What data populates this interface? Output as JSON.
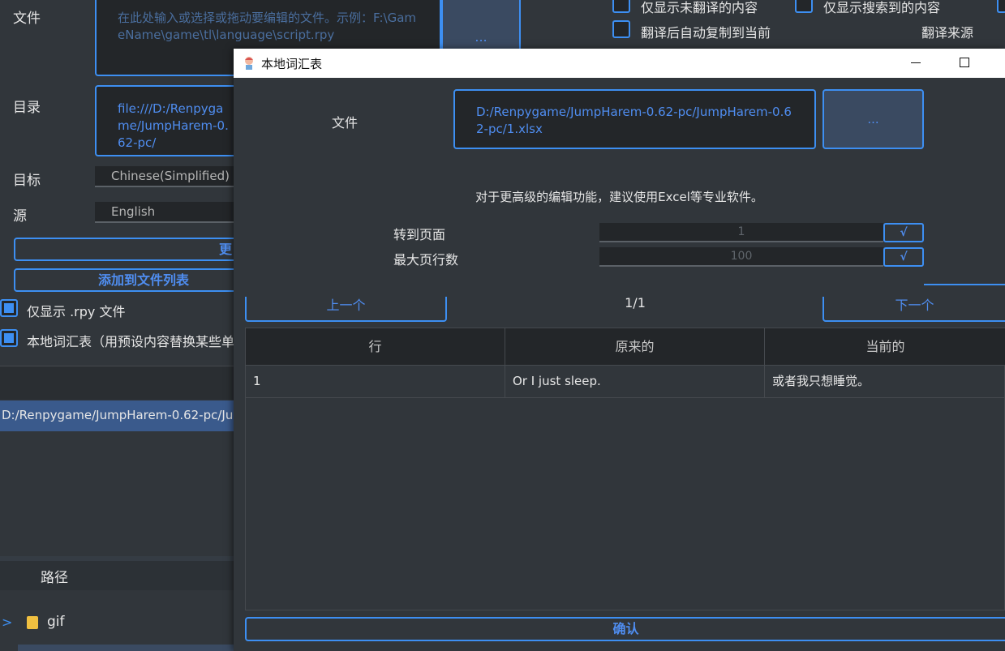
{
  "main": {
    "file_label": "文件",
    "file_placeholder": "在此处输入或选择或拖动要编辑的文件。示例：F:\\GameName\\game\\tl\\language\\script.rpy",
    "file_browse": "...",
    "dir_label": "目录",
    "dir_value": "file:///D:/Renpygame/JumpHarem-0.62-pc/",
    "target_label": "目标",
    "target_value": "Chinese(Simplified)",
    "source_label": "源",
    "source_value": "English",
    "button_update_partial": "更",
    "button_add_to_list": "添加到文件列表",
    "checkbox_rpy_only": "仅显示 .rpy 文件",
    "checkbox_local_glossary": "本地词汇表（用预设内容替换某些单",
    "checkbox_untranslated": "仅显示未翻译的内容",
    "checkbox_searched": "仅显示搜索到的内容",
    "checkbox_autocopy": "翻译后自动复制到当前",
    "translate_source_label": "翻译来源",
    "selected_path": "D:/Renpygame/JumpHarem-0.62-pc/Ju",
    "tree_header": "路径",
    "tree_item": "gif"
  },
  "dialog": {
    "title": "本地词汇表",
    "file_label": "文件",
    "file_value": "D:/Renpygame/JumpHarem-0.62-pc/JumpHarem-0.62-pc/1.xlsx",
    "browse_label": "...",
    "hint": "对于更高级的编辑功能，建议使用Excel等专业软件。",
    "goto_page_label": "转到页面",
    "goto_page_value": "1",
    "max_rows_label": "最大页行数",
    "max_rows_value": "100",
    "ok_mark": "√",
    "prev_label": "上一个",
    "next_label": "下一个",
    "page_indicator": "1/1",
    "columns": [
      "行",
      "原来的",
      "当前的"
    ],
    "rows": [
      {
        "row": "1",
        "original": "Or I just sleep.",
        "current": "或者我只想睡觉。"
      }
    ],
    "confirm_label": "确认"
  },
  "colors": {
    "accent": "#3d8ff2",
    "accent_text": "#4f8df0",
    "background": "#31363b",
    "field": "#232629"
  }
}
